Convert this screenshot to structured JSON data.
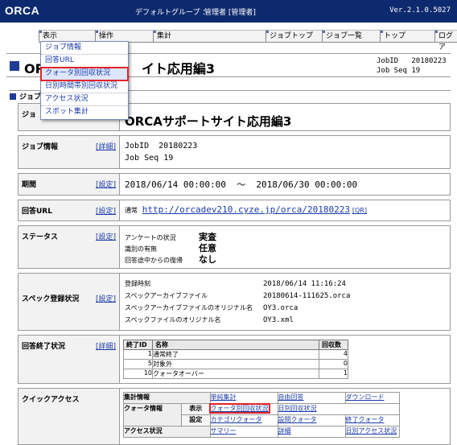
{
  "topbar": {
    "logo": "ORCA",
    "group": "デフォルトグループ ：",
    "user": "管理者 [管理者]",
    "version": "Ver.2.1.0.5027"
  },
  "menu": {
    "items": [
      {
        "label": "表示"
      },
      {
        "label": "操作"
      },
      {
        "label": "集計"
      },
      {
        "label": "ジョブトップ"
      },
      {
        "label": "ジョブ一覧"
      },
      {
        "label": "トップ"
      },
      {
        "label": "ログア"
      }
    ],
    "dropdown": [
      {
        "label": "ジョブ情報"
      },
      {
        "label": "回答URL"
      },
      {
        "label": "クォータ別回収状況"
      },
      {
        "label": "日別時間帯別回収状況"
      },
      {
        "label": "アクセス状況"
      },
      {
        "label": "スポット集計"
      }
    ]
  },
  "page": {
    "title": "ORCAサポートサイト応用編3",
    "title_visible": "OR",
    "title_tail": "イト応用編3",
    "jobid_label": "JobID",
    "jobid": "20180223",
    "jobseq_label": "Job Seq",
    "jobseq": "19",
    "section_label": "ジョブ"
  },
  "rows": {
    "jobname": {
      "label": "ジョ",
      "value": "ORCAサポートサイト応用編3"
    },
    "jobinfo": {
      "label": "ジョブ情報",
      "edit": "[詳細]",
      "jobid_k": "JobID",
      "jobid_v": "20180223",
      "seq_k": "Job Seq",
      "seq_v": "19"
    },
    "period": {
      "label": "期間",
      "edit": "[設定]",
      "from": "2018/06/14 00:00:00",
      "sep": "～",
      "to": "2018/06/30 00:00:00"
    },
    "url": {
      "label": "回答URL",
      "edit": "[設定]",
      "kind": "通常",
      "url": "http://orcadev210.cyze.jp/orca/20180223",
      "qr": "[QR]"
    },
    "status": {
      "label": "ステータス",
      "edit": "[設定]",
      "items": [
        {
          "k": "アンケートの状況",
          "v": "実査"
        },
        {
          "k": "識別の有無",
          "v": "任意"
        },
        {
          "k": "回答途中からの復帰",
          "v": "なし"
        }
      ]
    },
    "spec": {
      "label": "スペック登録状況",
      "edit": "[設定]",
      "items": [
        {
          "k": "登録時刻",
          "v": "2018/06/14 11:16:24"
        },
        {
          "k": "スペックアーカイブファイル",
          "v": "20180614-111625.orca"
        },
        {
          "k": "スペックアーカイブファイルのオリジナル名",
          "v": "OY3.orca"
        },
        {
          "k": "スペックファイルのオリジナル名",
          "v": "OY3.xml"
        }
      ]
    },
    "end": {
      "label": "回答終了状況",
      "edit": "[詳細]",
      "headers": [
        "終了ID",
        "名称",
        "回収数"
      ],
      "rows": [
        {
          "id": "1",
          "name": "通常終了",
          "count": "4"
        },
        {
          "id": "5",
          "name": "対象外",
          "count": "0"
        },
        {
          "id": "10",
          "name": "クォータオーバー",
          "count": "1"
        }
      ]
    },
    "quick": {
      "label": "クイックアクセス",
      "agg": {
        "h": "集計情報",
        "a": "単純集計",
        "b": "自由回答",
        "c": "ダウンロード"
      },
      "quota": {
        "h": "クォータ情報",
        "disp": "表示",
        "set": "設定",
        "a": "クォータ別回収状況",
        "b": "日別回収状況",
        "c": "カテゴリクォータ",
        "d": "設問クォータ",
        "e": "終了クォータ"
      },
      "access": {
        "h": "アクセス状況",
        "a": "サマリー",
        "b": "詳細",
        "c": "日別アクセス状況"
      }
    }
  }
}
